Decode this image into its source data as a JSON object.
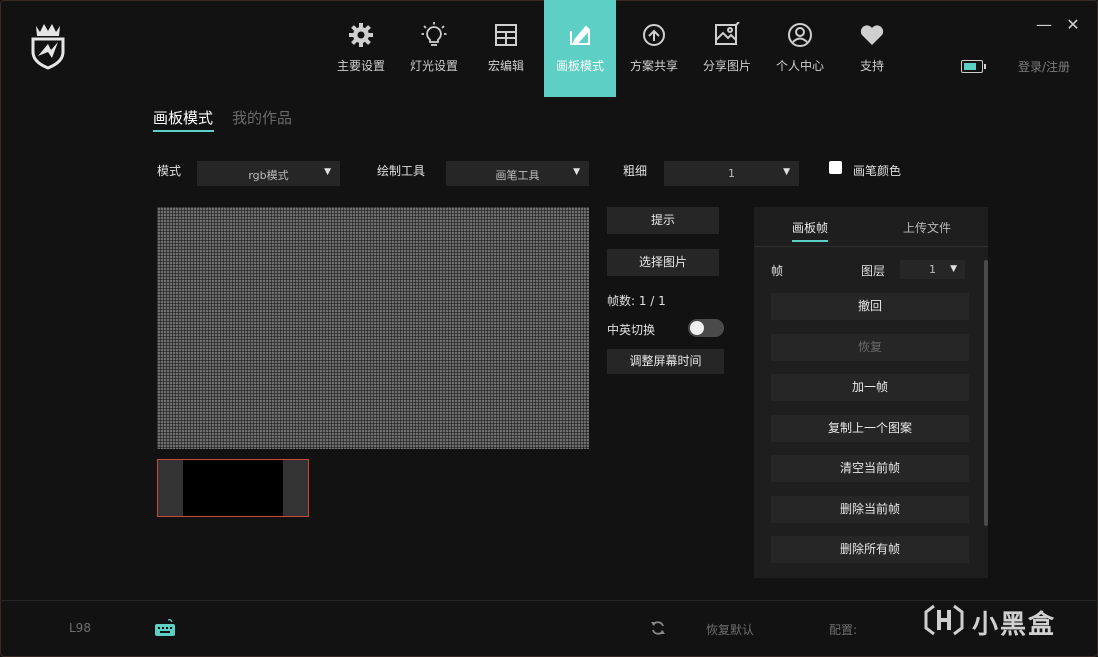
{
  "window": {
    "minimize_symbol": "—",
    "close_symbol": "✕"
  },
  "nav": {
    "items": [
      {
        "label": "主要设置",
        "icon": "gear-icon"
      },
      {
        "label": "灯光设置",
        "icon": "lightbulb-icon"
      },
      {
        "label": "宏编辑",
        "icon": "grid-icon"
      },
      {
        "label": "画板模式",
        "icon": "drawing-board-icon",
        "active": true
      },
      {
        "label": "方案共享",
        "icon": "share-profile-icon"
      },
      {
        "label": "分享图片",
        "icon": "share-image-icon"
      },
      {
        "label": "个人中心",
        "icon": "user-icon"
      },
      {
        "label": "支持",
        "icon": "heart-icon"
      }
    ],
    "login_label": "登录/注册",
    "battery_level": 0.75
  },
  "subtabs": [
    {
      "label": "画板模式",
      "active": true
    },
    {
      "label": "我的作品",
      "active": false
    }
  ],
  "options": {
    "mode_label": "模式",
    "mode_value": "rgb模式",
    "tool_label": "绘制工具",
    "tool_value": "画笔工具",
    "thickness_label": "粗细",
    "thickness_value": "1",
    "pen_color_label": "画笔颜色",
    "dropdown_arrow": "▼"
  },
  "controls": {
    "hint_button": "提示",
    "select_image_button": "选择图片",
    "frame_count": "帧数: 1 / 1",
    "lang_switch_label": "中英切换",
    "lang_switch_on": false,
    "adjust_screen_time_button": "调整屏幕时间"
  },
  "panel": {
    "tabs": [
      {
        "label": "画板帧",
        "active": true
      },
      {
        "label": "上传文件",
        "active": false
      }
    ],
    "frame_label": "帧",
    "layer_label": "图层",
    "layer_value": "1",
    "buttons": [
      {
        "label": "撤回",
        "disabled": false
      },
      {
        "label": "恢复",
        "disabled": true
      },
      {
        "label": "加一帧",
        "disabled": false
      },
      {
        "label": "复制上一个图案",
        "disabled": false
      },
      {
        "label": "清空当前帧",
        "disabled": false
      },
      {
        "label": "删除当前帧",
        "disabled": false
      },
      {
        "label": "删除所有帧",
        "disabled": false
      }
    ]
  },
  "footer": {
    "device": "L98",
    "reset_label": "恢复默认",
    "config_label": "配置:",
    "watermark_text": "小黑盒"
  },
  "colors": {
    "accent": "#5ecfc4",
    "background": "#121212",
    "panel": "#1e1e1e",
    "button": "#262626",
    "thumb_border": "#c9483a"
  }
}
